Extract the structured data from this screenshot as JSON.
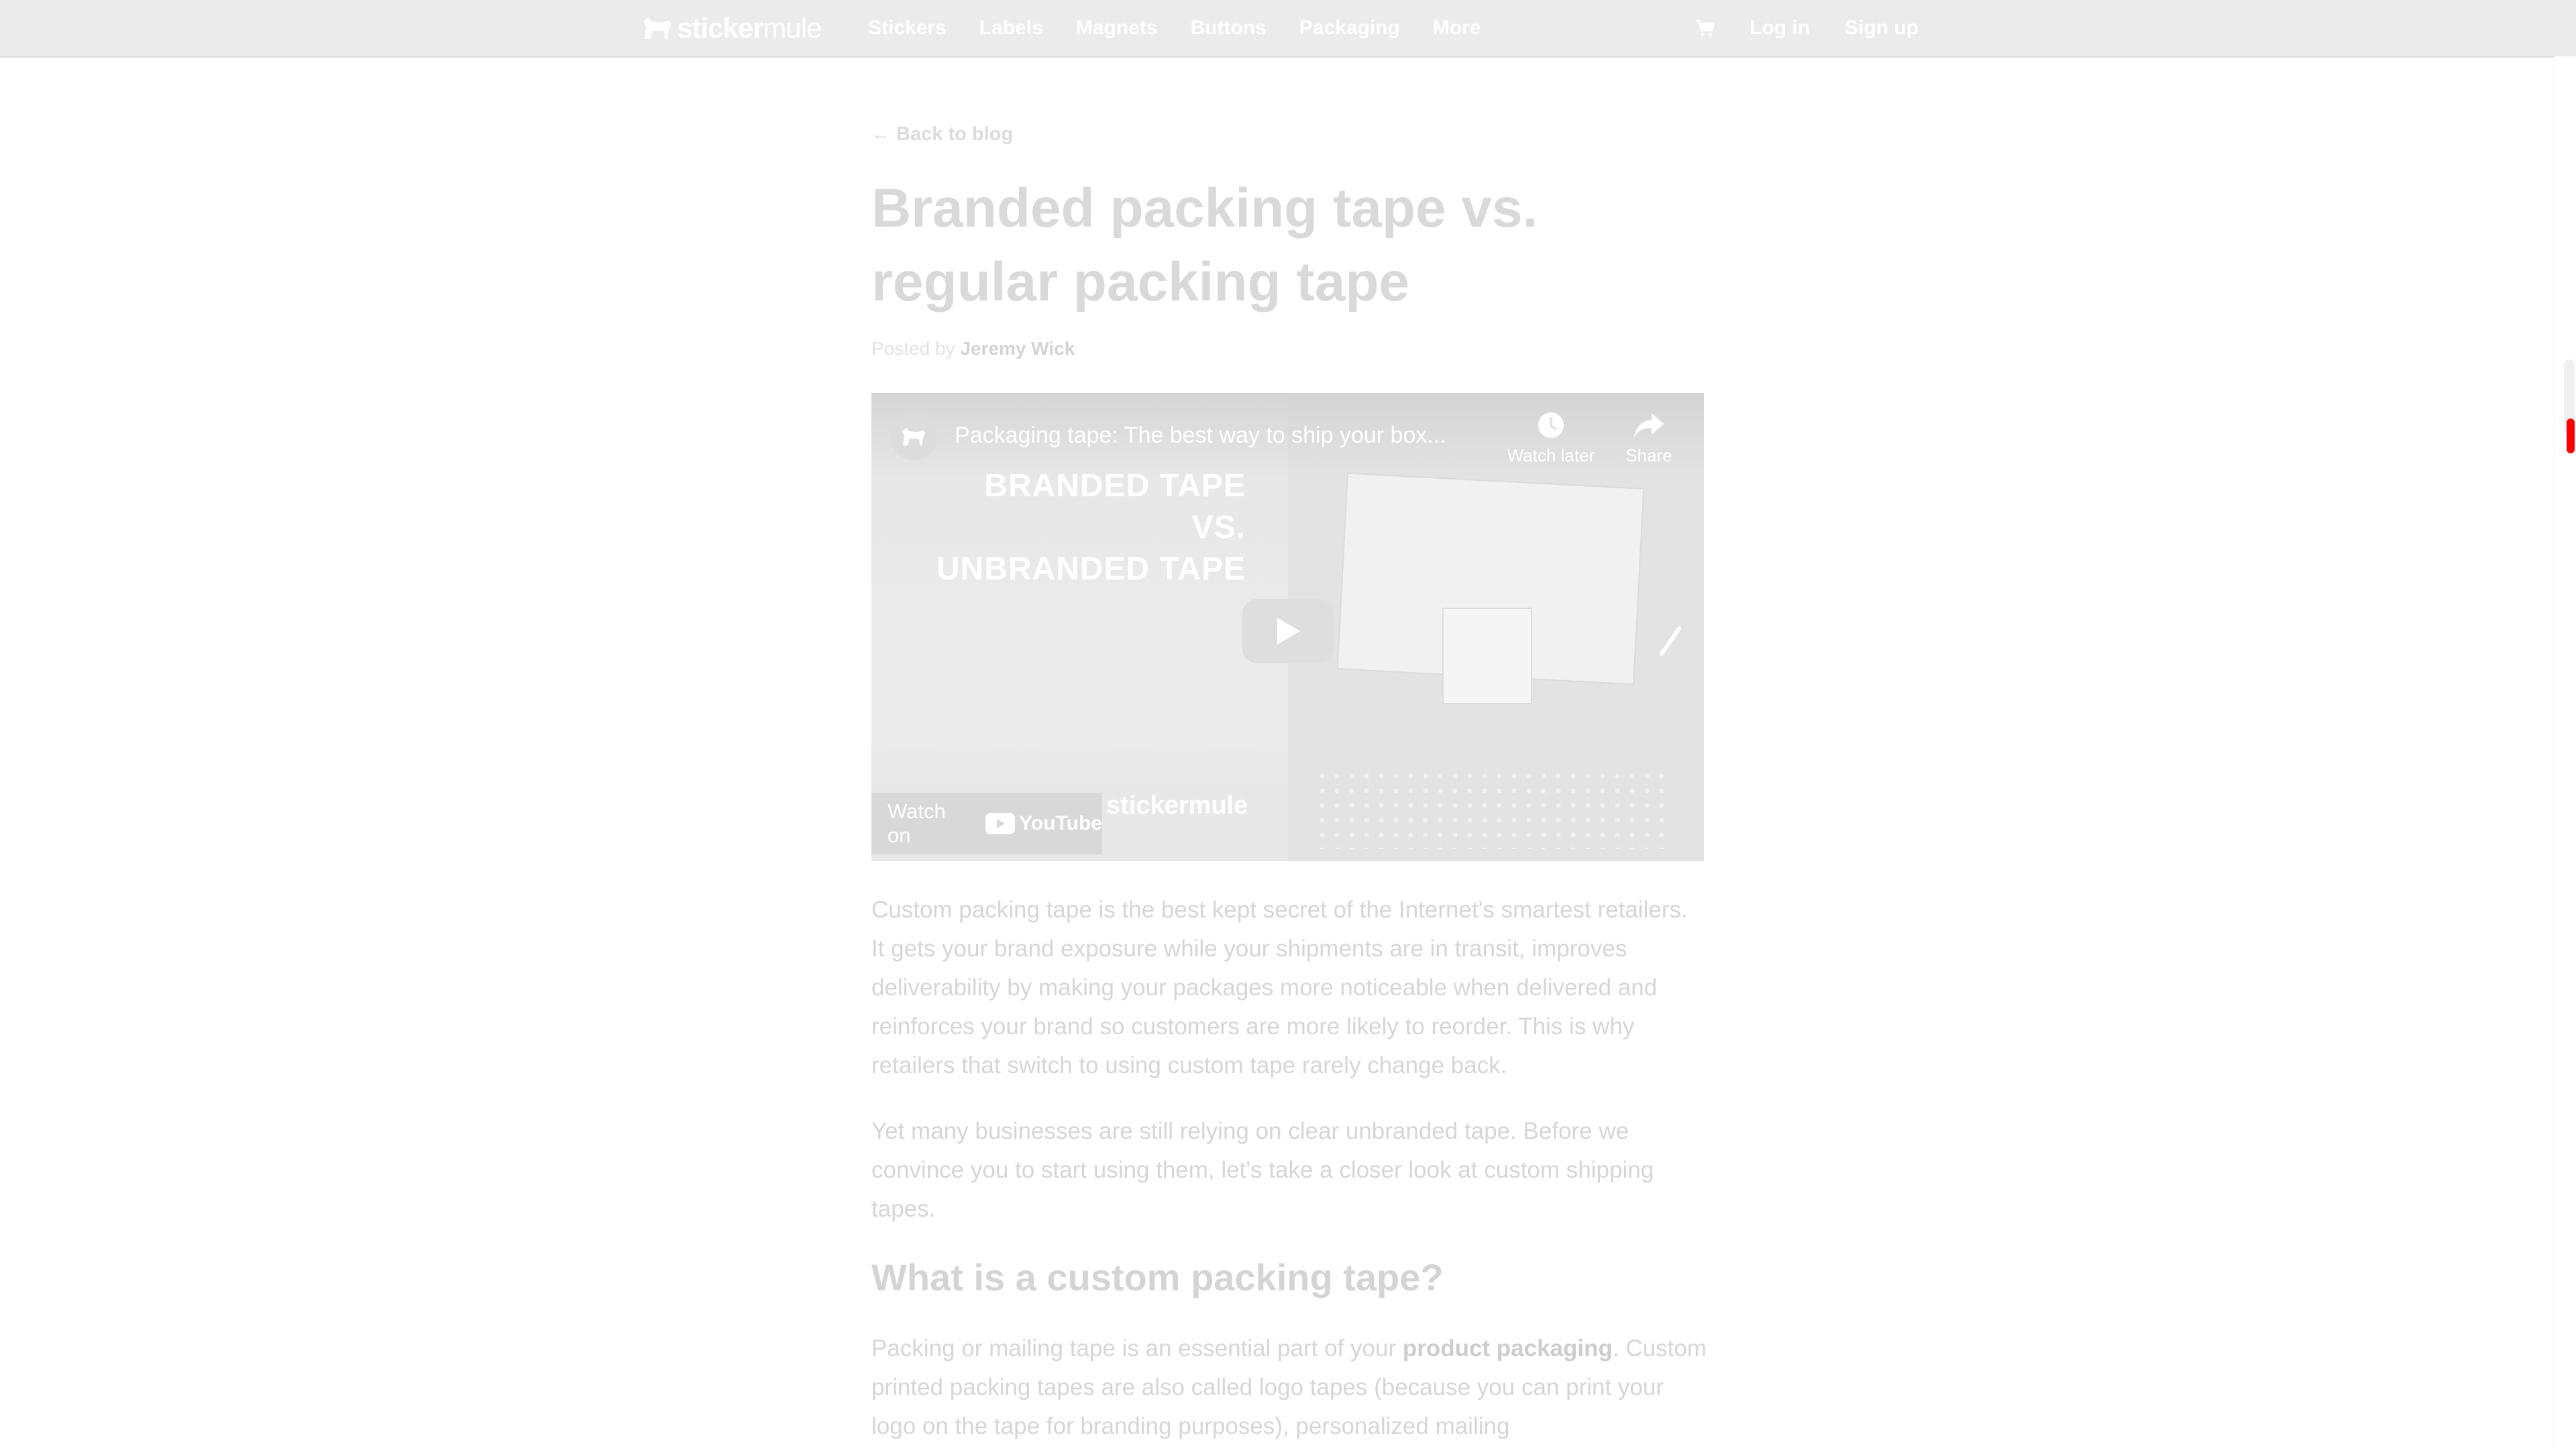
{
  "header": {
    "logo": {
      "bold": "sticker",
      "light": "mule"
    },
    "nav": [
      "Stickers",
      "Labels",
      "Magnets",
      "Buttons",
      "Packaging",
      "More"
    ],
    "login": "Log in",
    "signup": "Sign up"
  },
  "article": {
    "back_link": "← Back to blog",
    "title": "Branded packing tape vs. regular packing tape",
    "byline_prefix": "Posted by",
    "author": "Jeremy Wick",
    "video": {
      "title": "Packaging tape: The best way to ship your box...",
      "watch_later": "Watch later",
      "share": "Share",
      "overlay_lines": [
        "BRANDED TAPE",
        "VS.",
        "UNBRANDED TAPE"
      ],
      "watch_on": "Watch on",
      "youtube": "YouTube",
      "watermark": "stickermule"
    },
    "paragraph_1": "Custom packing tape is the best kept secret of the Internet's smartest retailers. It gets your brand exposure while your shipments are in transit, improves deliverability by making your packages more noticeable when delivered and reinforces your brand so customers are more likely to reorder. This is why retailers that switch to using custom tape rarely change back.",
    "paragraph_2": "Yet many businesses are still relying on clear unbranded tape. Before we convince you to start using them, let's take a closer look at custom shipping tapes.",
    "subheading": "What is a custom packing tape?",
    "paragraph_3_before": "Packing or mailing tape is an essential part of your ",
    "paragraph_3_link": "product packaging",
    "paragraph_3_after": ". Custom printed packing tapes are also called logo tapes (because you can print your logo on the tape for branding purposes), personalized mailing"
  },
  "colors": {
    "header_bg": "#ebebeb",
    "scroll_marker": "#ff0000"
  }
}
